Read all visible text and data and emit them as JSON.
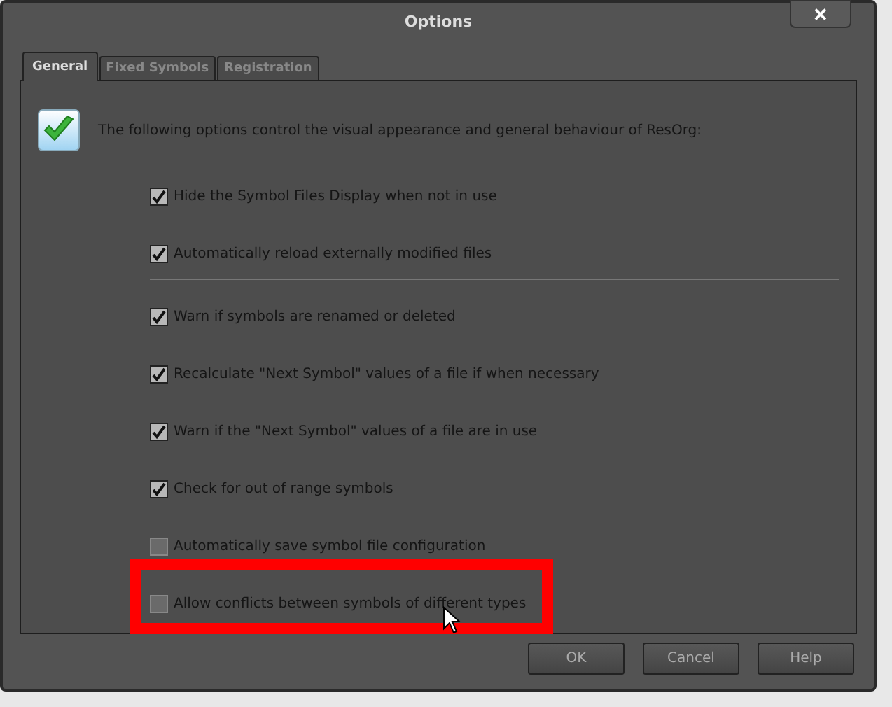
{
  "window": {
    "title": "Options",
    "close": "✕"
  },
  "tabs": [
    {
      "label": "General",
      "selected": true
    },
    {
      "label": "Fixed Symbols",
      "selected": false
    },
    {
      "label": "Registration",
      "selected": false
    }
  ],
  "intro": "The following options control the visual appearance and general behaviour of ResOrg:",
  "options": [
    {
      "kind": "checkbox",
      "label": "Hide the Symbol Files Display when not in use",
      "checked": true,
      "highlighted": false
    },
    {
      "kind": "checkbox",
      "label": "Automatically reload externally modified files",
      "checked": true,
      "highlighted": false
    },
    {
      "kind": "separator"
    },
    {
      "kind": "checkbox",
      "label": "Warn if symbols are renamed or deleted",
      "checked": true,
      "highlighted": false
    },
    {
      "kind": "checkbox",
      "label": "Recalculate \"Next Symbol\" values of a file if when necessary",
      "checked": true,
      "highlighted": false
    },
    {
      "kind": "checkbox",
      "label": "Warn if the \"Next Symbol\" values of a file are in use",
      "checked": true,
      "highlighted": false
    },
    {
      "kind": "checkbox",
      "label": "Check for out of range symbols",
      "checked": true,
      "highlighted": false
    },
    {
      "kind": "checkbox",
      "label": "Automatically save symbol file configuration",
      "checked": false,
      "highlighted": false
    },
    {
      "kind": "checkbox",
      "label": "Allow conflicts between symbols of different types",
      "checked": false,
      "highlighted": true
    }
  ],
  "buttons": [
    "OK",
    "Cancel",
    "Help"
  ]
}
